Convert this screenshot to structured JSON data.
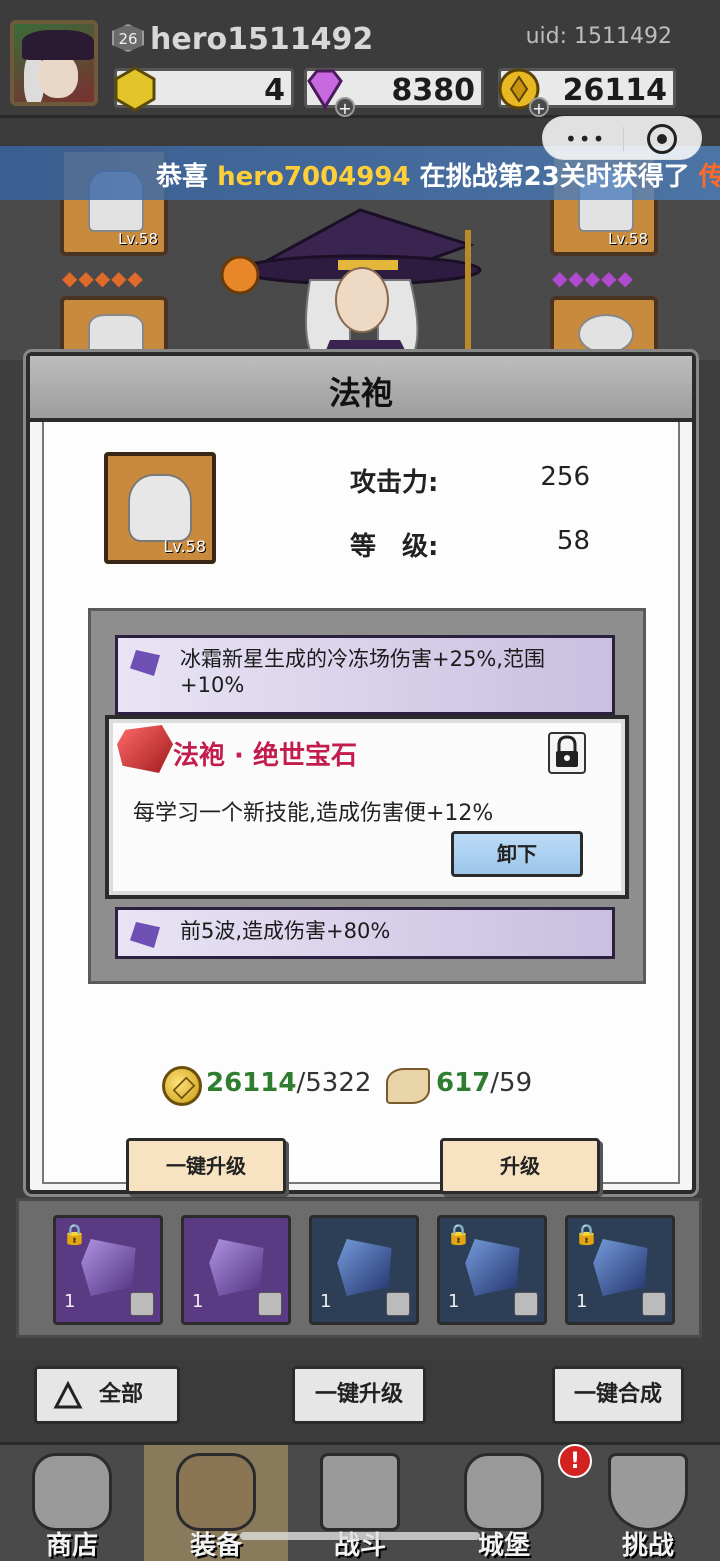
{
  "header": {
    "level": "26",
    "username": "hero1511492",
    "uid": "uid: 1511492",
    "energy": "4",
    "gems": "8380",
    "gold": "26114"
  },
  "marquee": {
    "prefix": "恭喜 ",
    "player": "hero7004994",
    "middle": " 在挑战第23关时获得了 ",
    "tail": "传"
  },
  "equipment": {
    "left_top_level": "Lv.58",
    "right_top_level": "Lv.58",
    "left_diamonds": "◆◆◆◆◆",
    "right_diamonds": "◆◆◆◆◆"
  },
  "modal": {
    "title": "法袍",
    "item_level": "Lv.58",
    "attack_label": "攻击力:",
    "attack_value": "256",
    "level_label": "等　级:",
    "level_value": "58",
    "gem_row_1": "冰霜新星生成的冷冻场伤害+25%,范围+10%",
    "gem_card_name": "法袍 · 绝世宝石",
    "gem_card_desc": "每学习一个新技能,造成伤害便+12%",
    "unequip_label": "卸下",
    "gem_row_2": "前5波,造成伤害+80%",
    "gold_have": "26114",
    "gold_need": "/5322",
    "scroll_have": "617",
    "scroll_need": "/59",
    "btn_upgrade_all": "一键升级",
    "btn_upgrade": "升级"
  },
  "gem_grid": [
    {
      "count": "1",
      "kind": "purple"
    },
    {
      "count": "1",
      "kind": "purple"
    },
    {
      "count": "1",
      "kind": "blue"
    },
    {
      "count": "1",
      "kind": "blue"
    },
    {
      "count": "1",
      "kind": "blue"
    }
  ],
  "actions": {
    "all": "全部",
    "upgrade_all": "一键升级",
    "combine_all": "一键合成"
  },
  "nav": {
    "shop": "商店",
    "equip": "装备",
    "battle": "战斗",
    "castle": "城堡",
    "challenge": "挑战",
    "badge": "!"
  },
  "colors": {
    "accent_gold": "#ffcf3a",
    "gem_name_red": "#c21d4d",
    "have_green": "#2f7d2f"
  }
}
